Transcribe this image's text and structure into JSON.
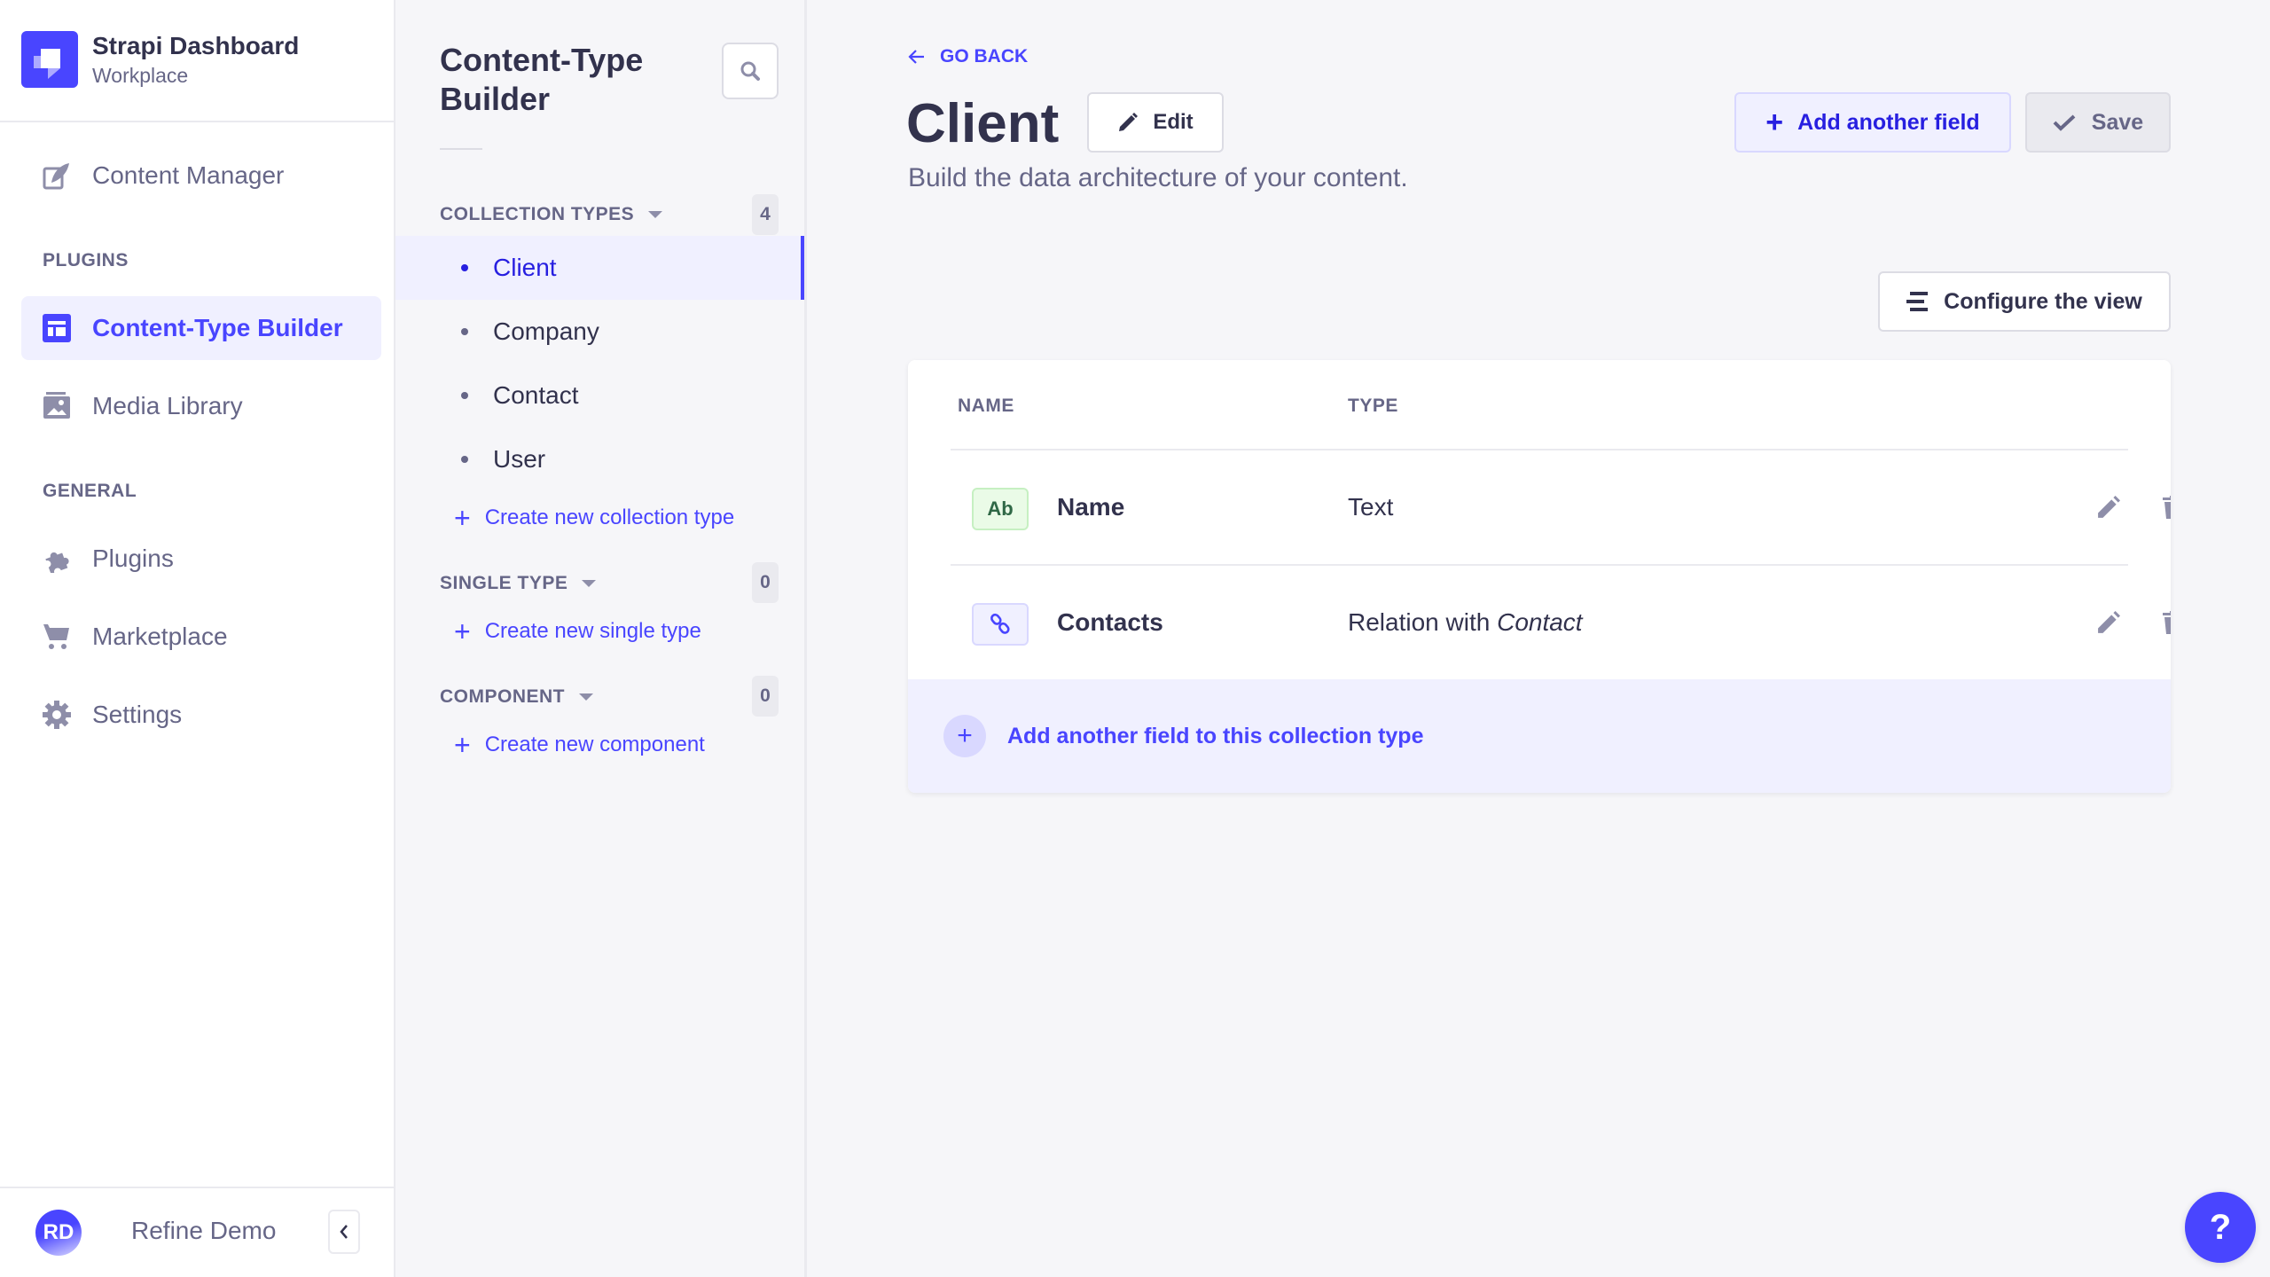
{
  "brand": {
    "title": "Strapi Dashboard",
    "subtitle": "Workplace"
  },
  "nav": {
    "content_manager": "Content Manager",
    "plugins_section": "PLUGINS",
    "ctb": "Content-Type Builder",
    "media_library": "Media Library",
    "general_section": "GENERAL",
    "plugins": "Plugins",
    "marketplace": "Marketplace",
    "settings": "Settings"
  },
  "user": {
    "initials": "RD",
    "name": "Refine Demo"
  },
  "subnav": {
    "title": "Content-Type Builder",
    "collection_types": {
      "label": "COLLECTION TYPES",
      "count": "4",
      "items": [
        {
          "name": "Client",
          "active": true
        },
        {
          "name": "Company"
        },
        {
          "name": "Contact"
        },
        {
          "name": "User"
        }
      ],
      "create": "Create new collection type"
    },
    "single_types": {
      "label": "SINGLE TYPE",
      "count": "0",
      "create": "Create new single type"
    },
    "components": {
      "label": "COMPONENT",
      "count": "0",
      "create": "Create new component"
    }
  },
  "main": {
    "go_back": "GO BACK",
    "title": "Client",
    "edit": "Edit",
    "subtitle": "Build the data architecture of your content.",
    "add_field": "Add another field",
    "save": "Save",
    "configure": "Configure the view",
    "table": {
      "headers": [
        "NAME",
        "TYPE"
      ],
      "rows": [
        {
          "icon": "Ab",
          "name": "Name",
          "type": "Text"
        },
        {
          "icon": "relation-icon",
          "name": "Contacts",
          "type_prefix": "Relation with",
          "type_target": "Contact"
        }
      ],
      "add_row": "Add another field to this collection type"
    }
  },
  "help": "?",
  "colors": {
    "primary": "#4945ff",
    "primary_light": "#f0f0ff",
    "text": "#32324d",
    "muted": "#666687"
  }
}
